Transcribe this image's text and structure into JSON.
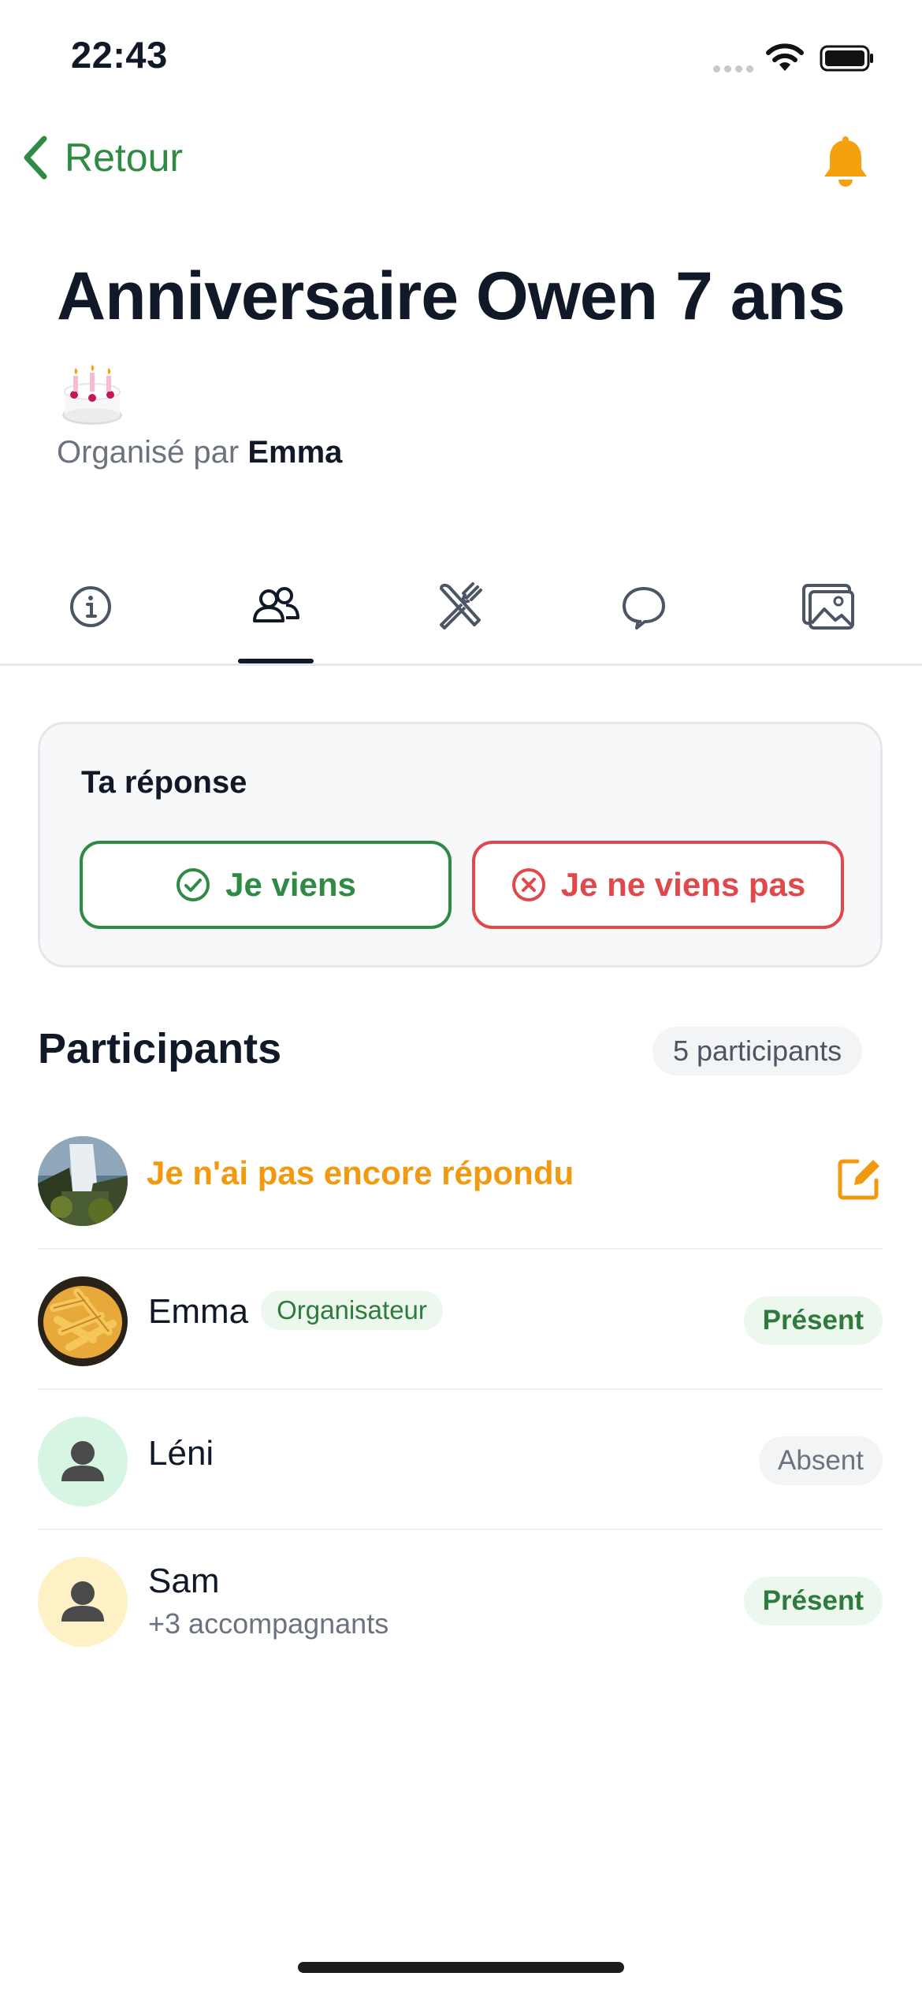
{
  "status_bar": {
    "time": "22:43"
  },
  "nav": {
    "back_label": "Retour"
  },
  "event": {
    "title": "Anniversaire Owen 7 ans",
    "emoji": "🎂",
    "organized_prefix": "Organisé par",
    "organizer": "Emma"
  },
  "tabs": [
    {
      "icon": "info-icon"
    },
    {
      "icon": "people-icon",
      "active": true
    },
    {
      "icon": "utensils-icon"
    },
    {
      "icon": "chat-icon"
    },
    {
      "icon": "photos-icon"
    }
  ],
  "response": {
    "title": "Ta réponse",
    "yes_label": "Je viens",
    "no_label": "Je ne viens pas"
  },
  "participants": {
    "title": "Participants",
    "count_label": "5 participants",
    "me_pending": "Je n'ai pas encore répondu",
    "rows": [
      {
        "name": "Emma",
        "badge": "Organisateur",
        "status": "Présent"
      },
      {
        "name": "Léni",
        "status": "Absent"
      },
      {
        "name": "Sam",
        "sub": "+3 accompagnants",
        "status": "Présent"
      }
    ]
  },
  "colors": {
    "accent_green": "#2f8a43",
    "danger_red": "#e0484b",
    "warning_orange": "#f29a0f",
    "text_dark": "#111827"
  }
}
